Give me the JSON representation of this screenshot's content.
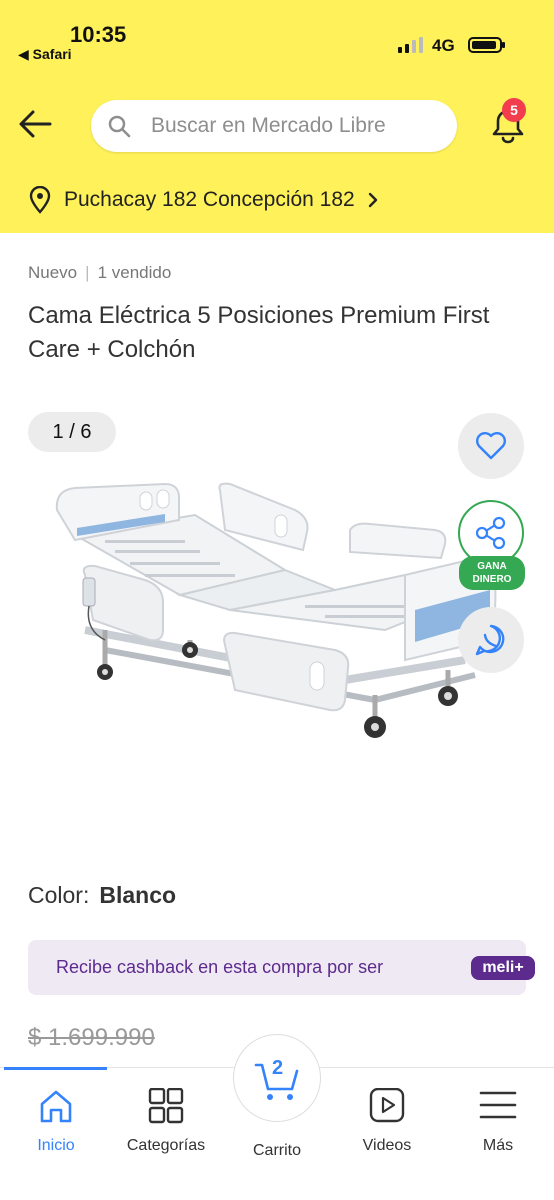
{
  "status_bar": {
    "time": "10:35",
    "back_app": "◀ Safari",
    "network": "4G"
  },
  "header": {
    "search_placeholder": "Buscar en Mercado Libre",
    "notifications_count": "5",
    "address": "Puchacay 182 Concepción 182",
    "bg_color": "#fff159"
  },
  "product": {
    "condition": "Nuevo",
    "sold": "1 vendido",
    "title": "Cama Eléctrica 5 Posiciones Premium First Care + Colchón",
    "image_counter": "1 / 6",
    "share_badge": "GANA DINERO",
    "color_label": "Color:",
    "color_value": "Blanco",
    "cashback_text": "Recibe cashback en esta compra por ser",
    "meli_badge": "meli+",
    "price_old": "$ 1.699.990"
  },
  "tabbar": {
    "items": [
      {
        "label": "Inicio",
        "icon": "home-icon",
        "active": true
      },
      {
        "label": "Categorías",
        "icon": "grid-icon"
      },
      {
        "label": "Carrito",
        "icon": "cart-icon",
        "badge": "2"
      },
      {
        "label": "Videos",
        "icon": "play-icon"
      },
      {
        "label": "Más",
        "icon": "menu-icon"
      }
    ],
    "accent": "#3483fa"
  }
}
